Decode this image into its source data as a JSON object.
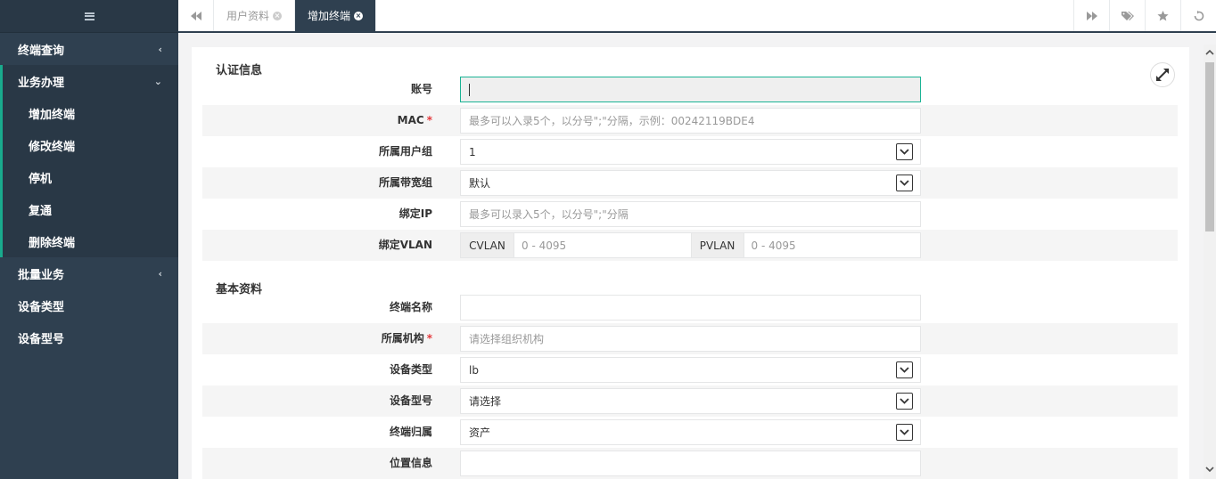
{
  "sidebar": {
    "menu": [
      {
        "label": "终端查询",
        "arrow": "‹"
      },
      {
        "label": "业务办理",
        "arrow": "⌄"
      },
      {
        "label": "批量业务",
        "arrow": "‹"
      },
      {
        "label": "设备类型"
      },
      {
        "label": "设备型号"
      }
    ],
    "submenu": [
      "增加终端",
      "修改终端",
      "停机",
      "复通",
      "删除终端"
    ]
  },
  "tabs": [
    {
      "label": "用户资料",
      "active": false
    },
    {
      "label": "增加终端",
      "active": true
    }
  ],
  "form": {
    "section_auth": "认证信息",
    "section_basic": "基本资料",
    "account_label": "账号",
    "mac_label": "MAC",
    "mac_placeholder": "最多可以入录5个，以分号\";\"分隔，示例：00242119BDE4",
    "user_group_label": "所属用户组",
    "user_group_value": "1",
    "bandwidth_group_label": "所属带宽组",
    "bandwidth_group_value": "默认",
    "bind_ip_label": "绑定IP",
    "bind_ip_placeholder": "最多可以录入5个，以分号\";\"分隔",
    "bind_vlan_label": "绑定VLAN",
    "cvlan_label": "CVLAN",
    "cvlan_placeholder": "0 - 4095",
    "pvlan_label": "PVLAN",
    "pvlan_placeholder": "0 - 4095",
    "terminal_name_label": "终端名称",
    "org_label": "所属机构",
    "org_placeholder": "请选择组织机构",
    "device_type_label": "设备类型",
    "device_type_value": "lb",
    "device_model_label": "设备型号",
    "device_model_value": "请选择",
    "terminal_owner_label": "终端归属",
    "terminal_owner_value": "资产",
    "location_label": "位置信息",
    "required_mark": "*"
  }
}
